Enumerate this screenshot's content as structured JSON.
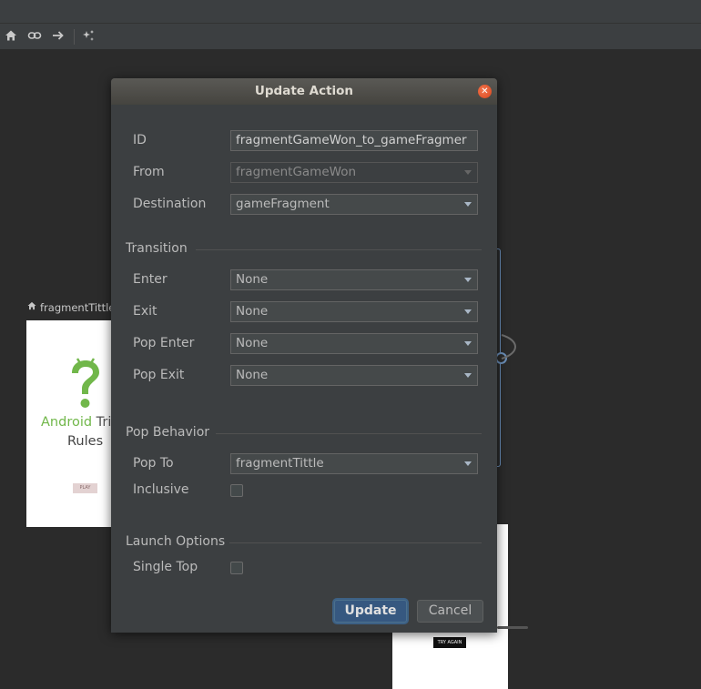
{
  "toolbar": {
    "icons": [
      "home-icon",
      "link-icon",
      "arrow-right-icon",
      "auto-arrange-icon"
    ]
  },
  "background": {
    "fragment_label": "fragmentTittle",
    "android_text_green": "Android",
    "android_text_rest": " Tri",
    "rules_text": "Rules",
    "play_label": "PLAY",
    "try_again_label": "TRY AGAIN"
  },
  "dialog": {
    "title": "Update Action",
    "id_label": "ID",
    "id_value": "fragmentGameWon_to_gameFragmer",
    "from_label": "From",
    "from_value": "fragmentGameWon",
    "destination_label": "Destination",
    "destination_value": "gameFragment",
    "transition_section": "Transition",
    "enter_label": "Enter",
    "enter_value": "None",
    "exit_label": "Exit",
    "exit_value": "None",
    "pop_enter_label": "Pop Enter",
    "pop_enter_value": "None",
    "pop_exit_label": "Pop Exit",
    "pop_exit_value": "None",
    "pop_behavior_section": "Pop Behavior",
    "pop_to_label": "Pop To",
    "pop_to_value": "fragmentTittle",
    "inclusive_label": "Inclusive",
    "launch_options_section": "Launch Options",
    "single_top_label": "Single Top",
    "update_button": "Update",
    "cancel_button": "Cancel"
  },
  "colors": {
    "accent": "#365880",
    "android_green": "#71b74a",
    "close_button": "#e2562b"
  }
}
